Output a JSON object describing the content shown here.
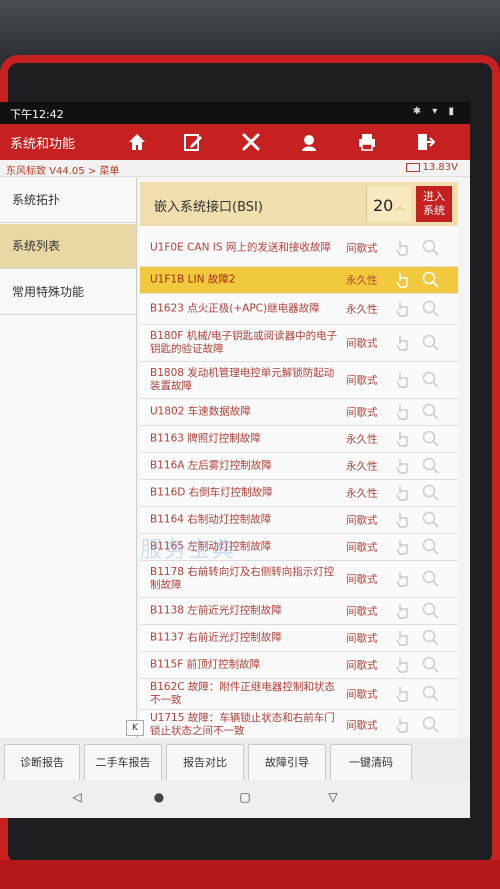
{
  "statusbar": {
    "time": "下午12:42"
  },
  "header": {
    "title": "系统和功能",
    "buttons": [
      "home-icon",
      "edit-icon",
      "tools-icon",
      "support-icon",
      "printer-icon",
      "exit-icon"
    ]
  },
  "breadcrumb": {
    "path": "东风标致 V44.05 > 菜单",
    "voltage": "13.83V"
  },
  "sidebar": {
    "items": [
      {
        "label": "系统拓扑"
      },
      {
        "label": "系统列表"
      },
      {
        "label": "常用特殊功能"
      }
    ]
  },
  "main": {
    "title": "嵌入系统接口(BSI)",
    "count": "20",
    "enter_label_1": "进入",
    "enter_label_2": "系统",
    "faults": [
      {
        "text": "U1F0E CAN IS 网上的发送和接收故障",
        "status": "间歇式"
      },
      {
        "text": "U1F1B LIN 故障2",
        "status": "永久性"
      },
      {
        "text": "B1623 点火正极(+APC)继电器故障",
        "status": "永久性"
      },
      {
        "text": "B180F 机械/电子钥匙或阅读器中的电子钥匙的验证故障",
        "status": "间歇式"
      },
      {
        "text": "B1808 发动机管理电控单元解锁防起动装置故障",
        "status": "间歇式"
      },
      {
        "text": "U1802 车速数据故障",
        "status": "间歇式"
      },
      {
        "text": "B1163 牌照灯控制故障",
        "status": "永久性"
      },
      {
        "text": "B116A 左后雾灯控制故障",
        "status": "永久性"
      },
      {
        "text": "B116D 右倒车灯控制故障",
        "status": "永久性"
      },
      {
        "text": "B1164 右制动灯控制故障",
        "status": "间歇式"
      },
      {
        "text": "B1165 左制动灯控制故障",
        "status": "间歇式"
      },
      {
        "text": "B1178 右前转向灯及右侧转向指示灯控制故障",
        "status": "间歇式"
      },
      {
        "text": "B1138 左前近光灯控制故障",
        "status": "间歇式"
      },
      {
        "text": "B1137 右前近光灯控制故障",
        "status": "间歇式"
      },
      {
        "text": "B115F 前顶灯控制故障",
        "status": "间歇式"
      },
      {
        "text": "B162C 故障：附件正继电器控制和状态不一致",
        "status": "间歇式"
      },
      {
        "text": "U1715 故障：车辆锁止状态和右前车门锁止状态之间不一致",
        "status": "间歇式"
      }
    ]
  },
  "bottom_buttons": [
    "诊断报告",
    "二手车报告",
    "报告对比",
    "故障引导",
    "一键清码"
  ],
  "watermark": "服务宝典",
  "collapse_label": "K"
}
